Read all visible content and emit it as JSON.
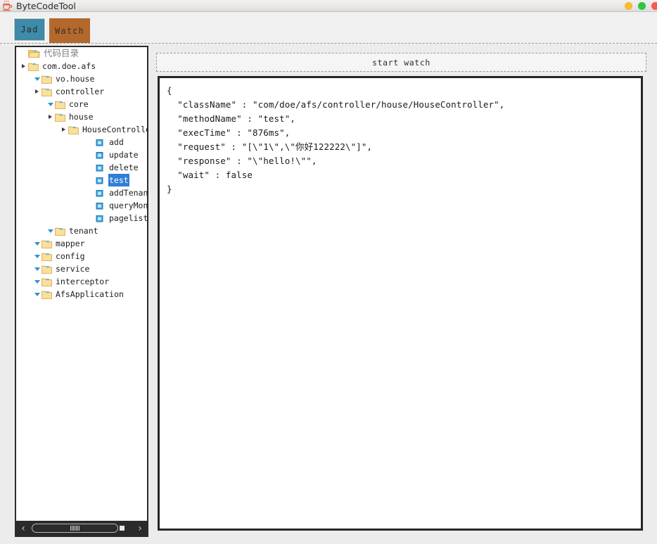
{
  "window": {
    "title": "ByteCodeTool",
    "app_icon": "coffee-cup-icon",
    "controls": {
      "minimize_color": "#fbbd2e",
      "maximize_color": "#2ec840",
      "close_color": "#fd5753"
    }
  },
  "tabs": [
    {
      "label": "Jad",
      "active": false,
      "color": "#3d8ba8"
    },
    {
      "label": "Watch",
      "active": true,
      "color": "#b3682c"
    }
  ],
  "tree": {
    "header": {
      "label": "代码目录",
      "icon": "open-folder-icon"
    },
    "nodes": [
      {
        "label": "com.doe.afs",
        "depth": 0,
        "type": "folder",
        "state": "collapsed",
        "selected": false
      },
      {
        "label": "vo.house",
        "depth": 1,
        "type": "folder",
        "state": "expanded",
        "selected": false
      },
      {
        "label": "controller",
        "depth": 1,
        "type": "folder",
        "state": "collapsed",
        "selected": false
      },
      {
        "label": "core",
        "depth": 2,
        "type": "folder",
        "state": "expanded",
        "selected": false
      },
      {
        "label": "house",
        "depth": 2,
        "type": "folder",
        "state": "collapsed",
        "selected": false
      },
      {
        "label": "HouseController",
        "depth": 3,
        "type": "folder",
        "state": "collapsed",
        "selected": false
      },
      {
        "label": "add",
        "depth": 5,
        "type": "method",
        "state": "leaf",
        "selected": false
      },
      {
        "label": "update",
        "depth": 5,
        "type": "method",
        "state": "leaf",
        "selected": false
      },
      {
        "label": "delete",
        "depth": 5,
        "type": "method",
        "state": "leaf",
        "selected": false
      },
      {
        "label": "test",
        "depth": 5,
        "type": "method",
        "state": "leaf",
        "selected": true
      },
      {
        "label": "addTenant",
        "depth": 5,
        "type": "method",
        "state": "leaf",
        "selected": false
      },
      {
        "label": "queryMonthRent",
        "depth": 5,
        "type": "method",
        "state": "leaf",
        "selected": false
      },
      {
        "label": "pagelist",
        "depth": 5,
        "type": "method",
        "state": "leaf",
        "selected": false
      },
      {
        "label": "tenant",
        "depth": 2,
        "type": "folder",
        "state": "expanded",
        "selected": false
      },
      {
        "label": "mapper",
        "depth": 1,
        "type": "folder",
        "state": "expanded",
        "selected": false
      },
      {
        "label": "config",
        "depth": 1,
        "type": "folder",
        "state": "expanded",
        "selected": false
      },
      {
        "label": "service",
        "depth": 1,
        "type": "folder",
        "state": "expanded",
        "selected": false
      },
      {
        "label": "interceptor",
        "depth": 1,
        "type": "folder",
        "state": "expanded",
        "selected": false
      },
      {
        "label": "AfsApplication",
        "depth": 1,
        "type": "folder",
        "state": "expanded",
        "selected": false
      }
    ],
    "scrollbar": {
      "left_arrow": "‹",
      "right_arrow": "›"
    }
  },
  "watch": {
    "button_label": "start watch"
  },
  "result": {
    "json_text": "{\n  \"className\" : \"com/doe/afs/controller/house/HouseController\",\n  \"methodName\" : \"test\",\n  \"execTime\" : \"876ms\",\n  \"request\" : \"[\\\"1\\\",\\\"你好122222\\\"]\",\n  \"response\" : \"\\\"hello!\\\"\",\n  \"wait\" : false\n}",
    "fields": {
      "className": "com/doe/afs/controller/house/HouseController",
      "methodName": "test",
      "execTime": "876ms",
      "request": "[\\\"1\\\",\\\"你好122222\\\"]",
      "response": "\\\"hello!\\\"",
      "wait": "false"
    }
  }
}
